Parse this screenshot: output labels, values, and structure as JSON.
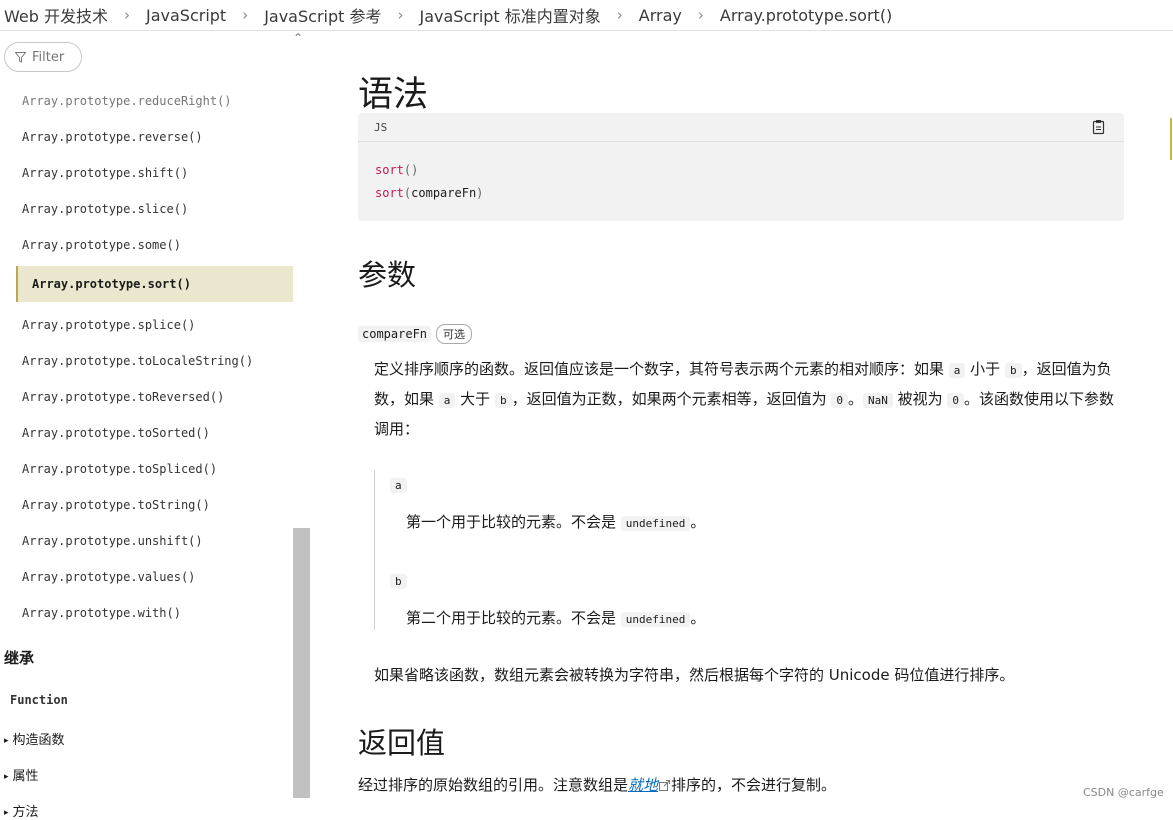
{
  "breadcrumb": [
    "Web 开发技术",
    "JavaScript",
    "JavaScript 参考",
    "JavaScript 标准内置对象",
    "Array",
    "Array.prototype.sort()"
  ],
  "sidebar": {
    "filter_label": "Filter",
    "items": [
      "Array.prototype.reduceRight()",
      "Array.prototype.reverse()",
      "Array.prototype.shift()",
      "Array.prototype.slice()",
      "Array.prototype.some()",
      "Array.prototype.sort()",
      "Array.prototype.splice()",
      "Array.prototype.toLocaleString()",
      "Array.prototype.toReversed()",
      "Array.prototype.toSorted()",
      "Array.prototype.toSpliced()",
      "Array.prototype.toString()",
      "Array.prototype.unshift()",
      "Array.prototype.values()",
      "Array.prototype.with()"
    ],
    "inheritance_heading": "继承",
    "function_link": "Function",
    "tree": [
      "构造函数",
      "属性",
      "方法"
    ]
  },
  "main": {
    "syntax_heading": "语法",
    "code": {
      "language": "JS",
      "line1_fn": "sort",
      "line1_paren": "()",
      "line2_fn": "sort",
      "line2_open": "(",
      "line2_arg": "compareFn",
      "line2_close": ")"
    },
    "params_heading": "参数",
    "param": {
      "name": "compareFn",
      "optional_badge": "可选",
      "desc": {
        "t1": "定义排序顺序的函数。返回值应该是一个数字，其符号表示两个元素的相对顺序：如果 ",
        "c1": "a",
        "t2": " 小于 ",
        "c2": "b",
        "t3": "，返回值为负数，如果 ",
        "c3": "a",
        "t4": " 大于 ",
        "c4": "b",
        "t5": "，返回值为正数，如果两个元素相等，返回值为 ",
        "c5": "0",
        "t6": "。",
        "c6": "NaN",
        "t7": " 被视为 ",
        "c7": "0",
        "t8": "。该函数使用以下参数调用："
      },
      "sub": [
        {
          "term": "a",
          "text": "第一个用于比较的元素。不会是 ",
          "code": "undefined",
          "end": "。"
        },
        {
          "term": "b",
          "text": "第二个用于比较的元素。不会是 ",
          "code": "undefined",
          "end": "。"
        }
      ],
      "omit_text": "如果省略该函数，数组元素会被转换为字符串，然后根据每个字符的 Unicode 码位值进行排序。"
    },
    "return_heading": "返回值",
    "return": {
      "before": "经过排序的原始数组的引用。注意数组是",
      "link": "就地",
      "after": "排序的，不会进行复制。"
    }
  },
  "watermark": "CSDN @carfge",
  "colors": {
    "accent": "#0069c2",
    "active_bg": "#ebe7cf",
    "active_border": "#b8a84e",
    "code_bg": "#f2f2f2",
    "keyword": "#c2185b"
  }
}
